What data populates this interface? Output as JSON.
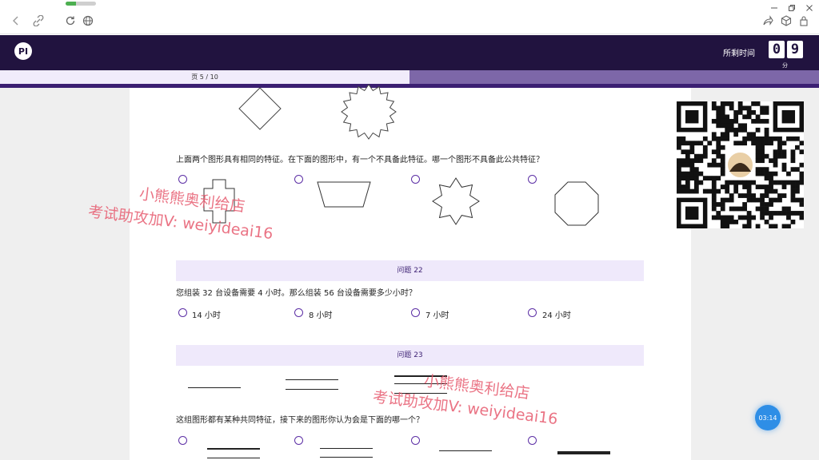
{
  "browser": {
    "load_progress": 0.35,
    "icons": [
      "back-icon",
      "link-icon",
      "reload-icon",
      "globe-icon",
      "share-icon",
      "cube-icon",
      "lock-icon",
      "minimize-icon",
      "restore-icon",
      "close-icon"
    ]
  },
  "header": {
    "logo_text": "PI",
    "time_label": "所剩时间",
    "minutes_digits": [
      "0",
      "9"
    ],
    "minutes_unit": "分"
  },
  "progress": {
    "label": "页 5 / 10",
    "fraction": 0.5
  },
  "q21": {
    "question": "上面两个图形具有相同的特征。在下面的图形中，有一个不具备此特征。哪一个图形不具备此公共特征？",
    "option_shapes": [
      "cross-shape",
      "trapezoid-shape",
      "eight-point-star-shape",
      "octagon-shape"
    ]
  },
  "q22": {
    "title": "问题 22",
    "question": "您组装 32 台设备需要 4 小时。那么组装 56 台设备需要多少小时？",
    "options": [
      "14 小时",
      "8 小时",
      "7 小时",
      "24 小时"
    ]
  },
  "q23": {
    "title": "问题 23",
    "question": "这组图形都有某种共同特征，接下来的图形你认为会是下面的哪一个？"
  },
  "watermarks": [
    {
      "line1": "小熊熊奥利给店",
      "line2": "考试助攻加V: weiyideai16"
    },
    {
      "line1": "小熊熊奥利给店",
      "line2": "考试助攻加V: weiyideai16"
    }
  ],
  "timer_bubble": "03:14",
  "colors": {
    "header": "#21133f",
    "accent": "#5c2fa5",
    "question_bar": "#efe9fb",
    "bubble": "#2e8ee6"
  }
}
